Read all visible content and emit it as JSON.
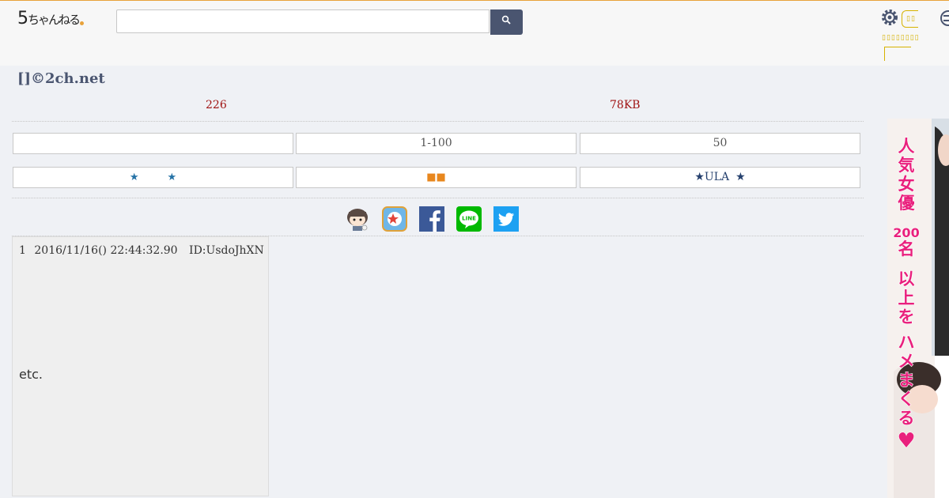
{
  "header": {
    "logo_main": "5",
    "logo_sub": "ちゃんねる",
    "search_value": "",
    "search_placeholder": ""
  },
  "thread": {
    "title": "[]©2ch.net",
    "post_count": "226",
    "size": "78KB"
  },
  "nav": {
    "row1": [
      "",
      "1-100",
      "50"
    ],
    "row2_mid": "■■",
    "row3_label": "ULA"
  },
  "post": {
    "number": "1",
    "date": "2016/11/16() 22:44:32.90",
    "id": "ID:UsdoJhXN",
    "body": "etc."
  },
  "ad": {
    "line1": "人気女優",
    "line2": "200名",
    "line3": "以上を",
    "line4": "ハメまくる♥"
  },
  "colors": {
    "accent": "#4a5570",
    "count_red": "#a01414",
    "star_blue": "#2572a6",
    "facebook": "#3b5998",
    "line": "#00b900",
    "twitter": "#1da1f2"
  }
}
